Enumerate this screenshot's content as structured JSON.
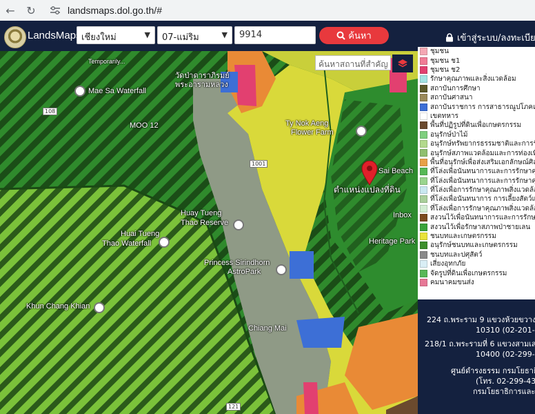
{
  "browser": {
    "url": "landsmaps.dol.go.th/#",
    "back_icon": "arrow-left-icon",
    "reload_icon": "reload-icon",
    "site_icon": "site-settings-icon"
  },
  "header": {
    "app_title": "LandsMaps",
    "province": "เชียงใหม่",
    "district": "07-แม่ริม",
    "parcel_number": "9914",
    "search_label": "ค้นหา",
    "login_label": "เข้าสู่ระบบ/ลงทะเบียน",
    "brand_color": "#14213f",
    "accent_color": "#e8393d"
  },
  "map": {
    "search_placeholder": "ค้นหาสถานที่สำคัญ",
    "labels": {
      "mae_sa": "Mae Sa Waterfall",
      "temporarily": "Temporarily...",
      "wat": "วัดป่าดาราภิรมย์",
      "wat2": "พระอารามหลวง",
      "moo12": "MOO 12",
      "huay": "Huay Tueng",
      "huay2": "Thao Reserve",
      "huai": "Huai Tueng",
      "huai2": "Thao Waterfall",
      "princess": "Princess Sirindhorn",
      "astro": "AstroPark",
      "khun": "Khun Chang Khian",
      "chiang": "Chiang Mai",
      "nok": "Ty Nok Aeng",
      "flower": "Flower Farm",
      "sai": "Sai Beach",
      "parcel": "ตำแหน่งแปลงที่ดิน",
      "inbox": "Inbox",
      "heritage": "Heritage Park",
      "shield_108": "108",
      "shield_1001": "1001",
      "shield_121": "121"
    }
  },
  "legend": [
    {
      "label": "ชุมชน",
      "color": "#f4a8b4"
    },
    {
      "label": "ชุมชน ช1",
      "color": "#f07c96"
    },
    {
      "label": "ชุมชน ช2",
      "color": "#e24070"
    },
    {
      "label": "รักษาคุณภาพและสิ่งแวดล้อม",
      "color": "#a3e3e3"
    },
    {
      "label": "สถาบันการศึกษา",
      "color": "#5c5a2a"
    },
    {
      "label": "สถาบันศาสนา",
      "color": "#9b8a5a"
    },
    {
      "label": "สถาบันราชการ การสาธารณูปโภคและสาธารณูปการ",
      "color": "#3d6fd6"
    },
    {
      "label": "เขตทหาร",
      "color": "#ffffff"
    },
    {
      "label": "พื้นที่ปฏิรูปที่ดินเพื่อเกษตรกรรม",
      "color": "#6b4a2e"
    },
    {
      "label": "อนุรักษ์ป่าไม้",
      "color": "#7fcf7f"
    },
    {
      "label": "อนุรักษ์ทรัพยากรธรรมชาติและการรักษาคุณภาพ",
      "color": "#b3d98c"
    },
    {
      "label": "อนุรักษ์สภาพแวดล้อมและการท่องเที่ยว",
      "color": "#8fbf6f"
    },
    {
      "label": "พื้นที่อนุรักษ์เพื่อส่งเสริมเอกลักษณ์ศิลปวัฒนธรรม",
      "color": "#e8a048"
    },
    {
      "label": "ที่โล่งเพื่อนันทนาการและการรักษาคุณภาพสิ่งแวดล้อม",
      "color": "#56b956"
    },
    {
      "label": "ที่โล่งเพื่อนันทนาการและการรักษาคุณภาพสิ่งแวดล้อม",
      "color": "#9ad58e"
    },
    {
      "label": "ที่โล่งเพื่อการรักษาคุณภาพสิ่งแวดล้อมการประมง",
      "color": "#c9e8f0"
    },
    {
      "label": "ที่โล่งเพื่อนันทนาการ การเลี้ยงสัตว์และการรักษา",
      "color": "#a9cf9a"
    },
    {
      "label": "ที่โล่งเพื่อการรักษาคุณภาพสิ่งแวดล้อม",
      "color": "#d2edd2"
    },
    {
      "label": "สงวนไว้เพื่อนันทนาการและการรักษาคุณภาพ",
      "color": "#7b4a1e"
    },
    {
      "label": "สงวนไว้เพื่อรักษาสภาพป่าชายเลน",
      "color": "#3aa33a"
    },
    {
      "label": "ชนบทและเกษตรกรรม",
      "color": "#e9e33a"
    },
    {
      "label": "อนุรักษ์ชนบทและเกษตรกรรม",
      "color": "#3d8f2d"
    },
    {
      "label": "ชนบทและปศุสัตว์",
      "color": "#8a8a8a"
    },
    {
      "label": "เสี่ยงอุทกภัย",
      "color": "#d9eef5"
    },
    {
      "label": "จัดรูปที่ดินเพื่อเกษตรกรรม",
      "color": "#58b858"
    },
    {
      "label": "คมนาคมขนส่ง",
      "color": "#e77896"
    }
  ],
  "info": {
    "addr1_line1": "224 ถ.พระราม 9 แขวงห้วยขวาง เขต",
    "addr1_line2": "10310 (02-201-80",
    "addr2_line1": "218/1 ถ.พระรามที่ 6 แขวงสามเสนใน",
    "addr2_line2": "10400 (02-299-40",
    "center_line1": "ศูนย์ดำรงธรรม กรมโยธาธิกา",
    "center_line2": "(โทร. 02-299-431",
    "center_line3": "กรมโยธาธิการและผัง"
  }
}
